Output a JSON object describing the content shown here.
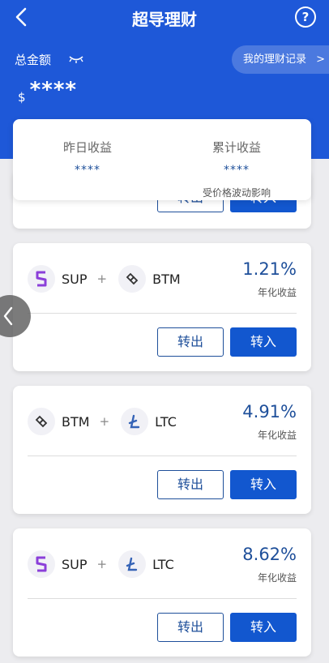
{
  "header": {
    "title": "超导理财",
    "help_label": "?",
    "total_label": "总金额",
    "records_label": "我的理财记录",
    "records_chevron": ">",
    "currency_symbol": "$",
    "balance": "****"
  },
  "summary": {
    "yesterday_label": "昨日收益",
    "yesterday_value": "****",
    "cumulative_label": "累计收益",
    "cumulative_value": "****",
    "note": "受价格波动影响"
  },
  "buttons": {
    "transfer_out": "转出",
    "transfer_in": "转入"
  },
  "products": [
    {
      "coin_a": "SUP",
      "coin_b": "BTM",
      "plus": "+",
      "rate": "1.21%",
      "rate_label": "年化收益",
      "icon_a": "sup-icon",
      "icon_b": "btm-icon"
    },
    {
      "coin_a": "BTM",
      "coin_b": "LTC",
      "plus": "+",
      "rate": "4.91%",
      "rate_label": "年化收益",
      "icon_a": "btm-icon",
      "icon_b": "ltc-icon"
    },
    {
      "coin_a": "SUP",
      "coin_b": "LTC",
      "plus": "+",
      "rate": "8.62%",
      "rate_label": "年化收益",
      "icon_a": "sup-icon",
      "icon_b": "ltc-icon"
    }
  ],
  "colors": {
    "header_bg": "#1e58d8",
    "accent": "#1e4f9a",
    "button_blue": "#1257cf"
  }
}
